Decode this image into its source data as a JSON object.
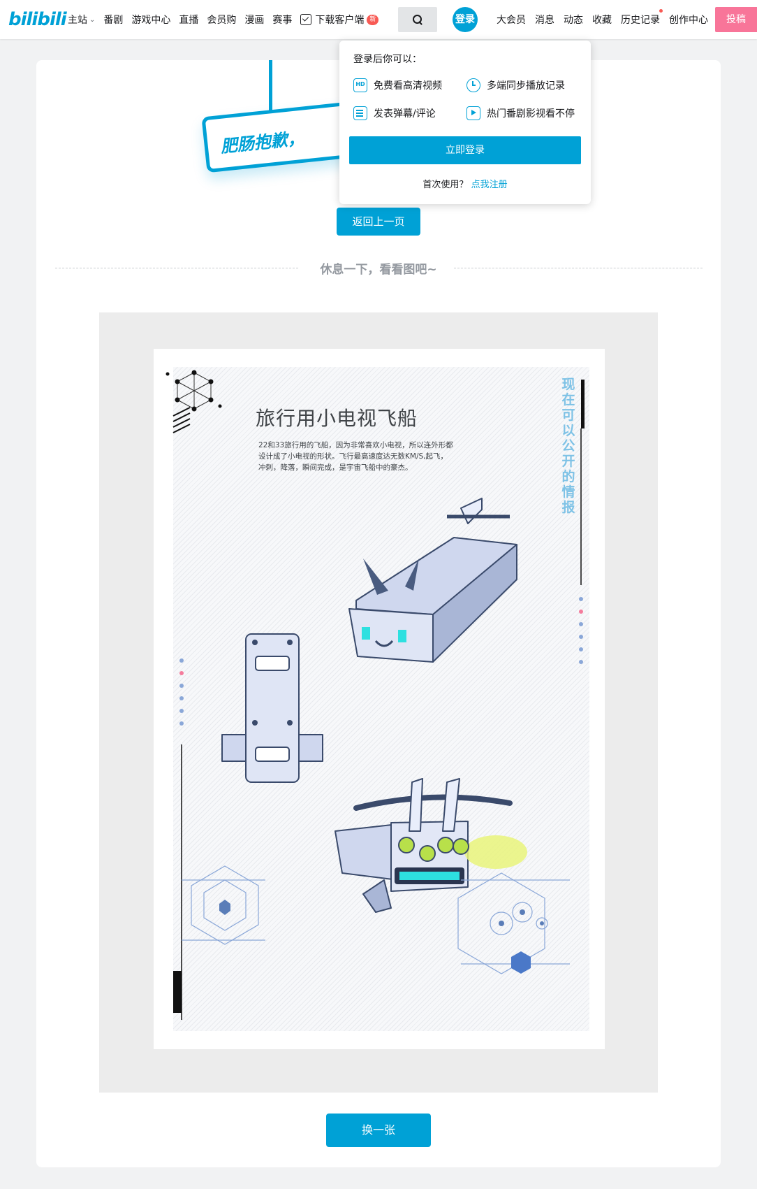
{
  "header": {
    "logo": "bilibili",
    "nav_left": [
      {
        "label": "主站",
        "has_chevron": true
      },
      {
        "label": "番剧"
      },
      {
        "label": "游戏中心"
      },
      {
        "label": "直播"
      },
      {
        "label": "会员购"
      },
      {
        "label": "漫画"
      },
      {
        "label": "赛事"
      }
    ],
    "download": {
      "label": "下载客户端",
      "badge": "新"
    },
    "search_icon": "search-icon",
    "login_avatar": "登录",
    "nav_right": [
      {
        "label": "大会员"
      },
      {
        "label": "消息"
      },
      {
        "label": "动态"
      },
      {
        "label": "收藏"
      },
      {
        "label": "历史记录",
        "dot": true
      },
      {
        "label": "创作中心"
      }
    ],
    "upload_label": "投稿"
  },
  "error": {
    "sign_text": "肥肠抱歉，",
    "back_label": "返回上一页"
  },
  "divider_text": "休息一下，看看图吧~",
  "poster": {
    "title": "旅行用小电视飞船",
    "description": "22和33旅行用的飞船，因为非常喜欢小电视，所以连外形都设计成了小电视的形状。飞行最高速度达无数KM/S,起飞，冲刺，降落，瞬间完成，是宇宙飞船中的豪杰。",
    "vertical_text": "现在可以公开的情报"
  },
  "swap_label": "换一张",
  "popover": {
    "title": "登录后你可以：",
    "benefits": [
      {
        "icon": "hd-icon",
        "label": "免费看高清视频"
      },
      {
        "icon": "clock-icon",
        "label": "多端同步播放记录"
      },
      {
        "icon": "list-icon",
        "label": "发表弹幕/评论"
      },
      {
        "icon": "play-icon",
        "label": "热门番剧影视看不停"
      }
    ],
    "login_label": "立即登录",
    "register_prompt": "首次使用？",
    "register_link": "点我注册"
  },
  "colors": {
    "accent": "#00a1d6",
    "upload": "#f87599",
    "badge": "#f85a54"
  }
}
